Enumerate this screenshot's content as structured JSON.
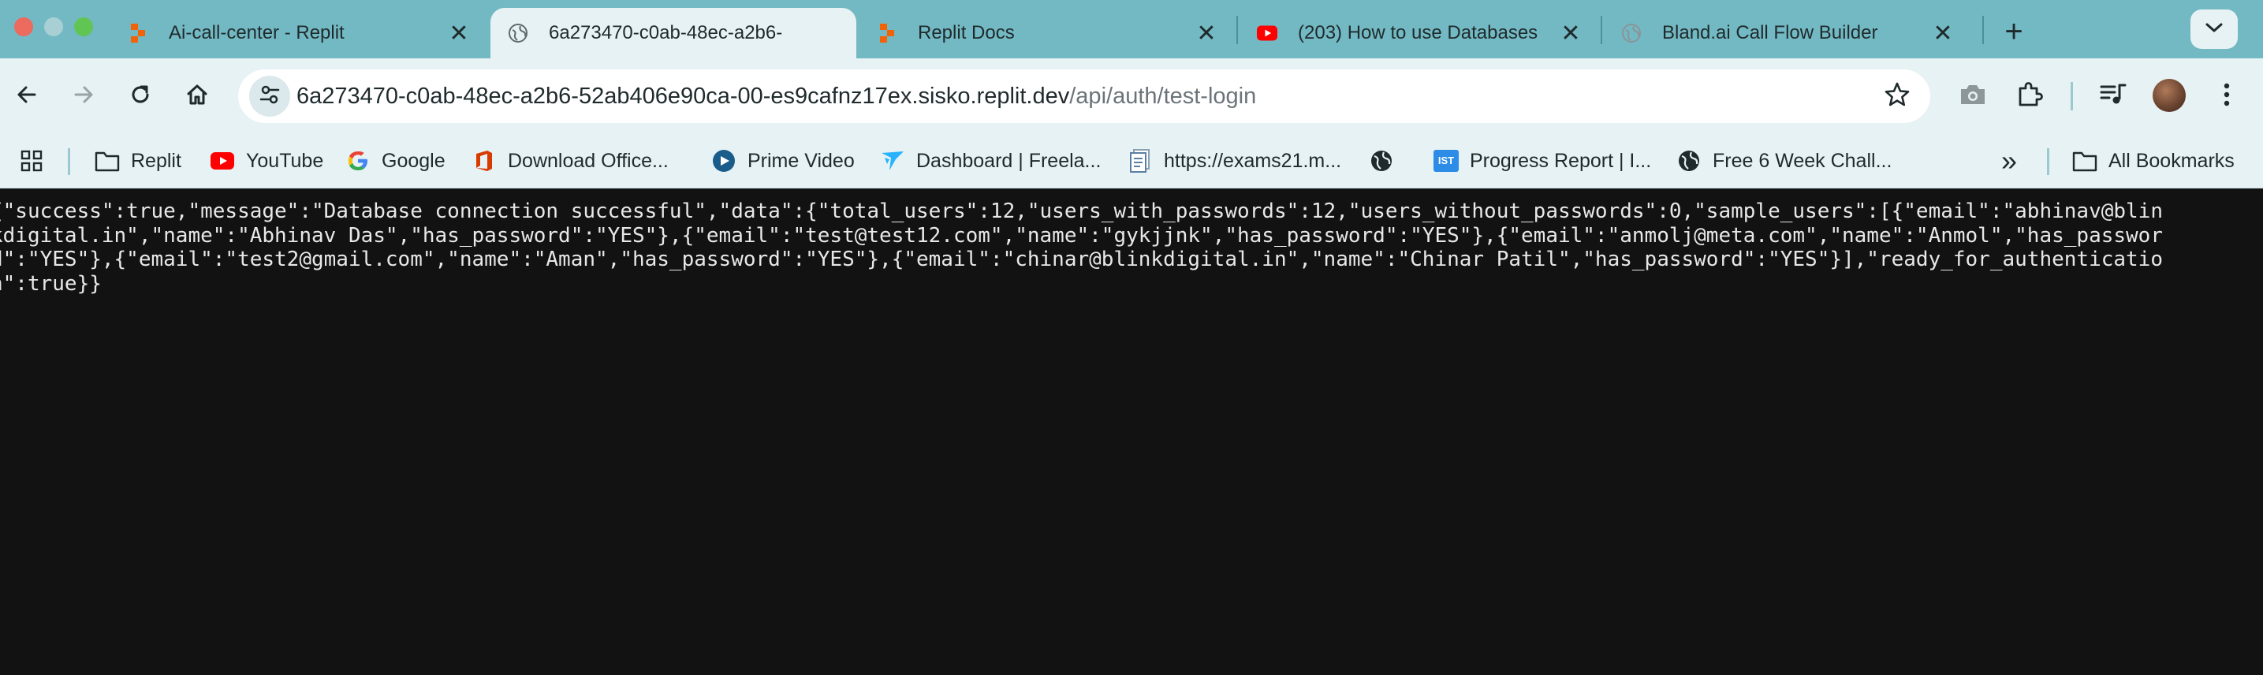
{
  "tabs": [
    {
      "title": "Ai-call-center - Replit",
      "favicon": "replit-icon",
      "active": false
    },
    {
      "title": "6a273470-c0ab-48ec-a2b6-",
      "favicon": "globe-icon",
      "active": true
    },
    {
      "title": "Replit Docs",
      "favicon": "replit-icon",
      "active": false
    },
    {
      "title": "(203) How to use Databases",
      "favicon": "youtube-icon",
      "active": false
    },
    {
      "title": "Bland.ai Call Flow Builder",
      "favicon": "globe-icon",
      "active": false
    }
  ],
  "tab_close_glyph": "✕",
  "new_tab_glyph": "+",
  "address_bar": {
    "host": "6a273470-c0ab-48ec-a2b6-52ab406e90ca-00-es9cafnz17ex.sisko.replit.dev",
    "path": "/api/auth/test-login"
  },
  "bookmarks": [
    {
      "label": "Replit",
      "icon": "folder-icon"
    },
    {
      "label": "YouTube",
      "icon": "youtube-icon"
    },
    {
      "label": "Google",
      "icon": "google-icon"
    },
    {
      "label": "Download Office...",
      "icon": "office-icon"
    },
    {
      "label": "Prime Video",
      "icon": "prime-video-icon"
    },
    {
      "label": "Dashboard | Freela...",
      "icon": "freelancer-icon"
    },
    {
      "label": "https://exams21.m...",
      "icon": "document-icon"
    },
    {
      "label": "",
      "icon": "globe-icon"
    },
    {
      "label": "Progress Report | I...",
      "icon": "ist-icon"
    },
    {
      "label": "Free 6 Week Chall...",
      "icon": "globe-icon"
    }
  ],
  "bookmarks_overflow_glyph": "»",
  "all_bookmarks_label": "All Bookmarks",
  "ist_badge": "IST",
  "response_json": "{\"success\":true,\"message\":\"Database connection successful\",\"data\":{\"total_users\":12,\"users_with_passwords\":12,\"users_without_passwords\":0,\"sample_users\":[{\"email\":\"abhinav@blinkdigital.in\",\"name\":\"Abhinav Das\",\"has_password\":\"YES\"},{\"email\":\"test@test12.com\",\"name\":\"gykjjnk\",\"has_password\":\"YES\"},{\"email\":\"anmolj@meta.com\",\"name\":\"Anmol\",\"has_password\":\"YES\"},{\"email\":\"test2@gmail.com\",\"name\":\"Aman\",\"has_password\":\"YES\"},{\"email\":\"chinar@blinkdigital.in\",\"name\":\"Chinar Patil\",\"has_password\":\"YES\"}],\"ready_for_authentication\":true}}",
  "colors": {
    "tabstrip": "#73b9c3",
    "toolbar": "#e7f2f4",
    "content_bg": "#121212",
    "content_text": "#e8e8e8"
  }
}
